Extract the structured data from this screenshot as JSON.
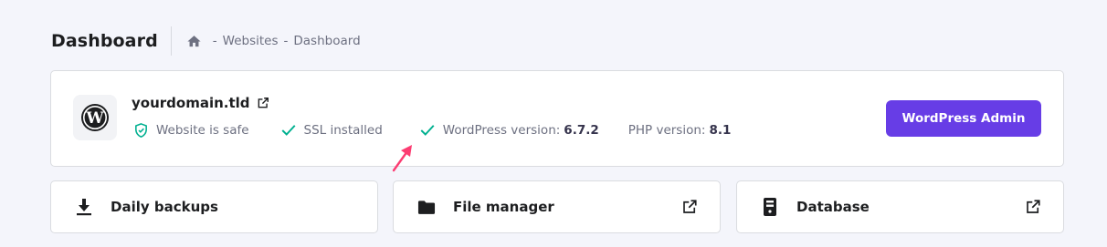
{
  "header": {
    "title": "Dashboard",
    "breadcrumb": [
      "Websites",
      "Dashboard"
    ],
    "separator": "-"
  },
  "site": {
    "domain": "yourdomain.tld",
    "status": {
      "safe": "Website is safe",
      "ssl": "SSL installed",
      "wp_label": "WordPress version:",
      "wp_version": "6.7.2",
      "php_label": "PHP version:",
      "php_version": "8.1"
    },
    "admin_button": "WordPress Admin"
  },
  "quick_links": {
    "backups": "Daily backups",
    "files": "File manager",
    "database": "Database"
  },
  "colors": {
    "accent": "#673de6",
    "success": "#00b090",
    "arrow": "#fc3d72",
    "background": "#f4f5fb"
  },
  "icons": [
    "home-icon",
    "wordpress-icon",
    "external-link-icon",
    "shield-check-icon",
    "check-icon",
    "download-icon",
    "folder-icon",
    "database-icon"
  ]
}
